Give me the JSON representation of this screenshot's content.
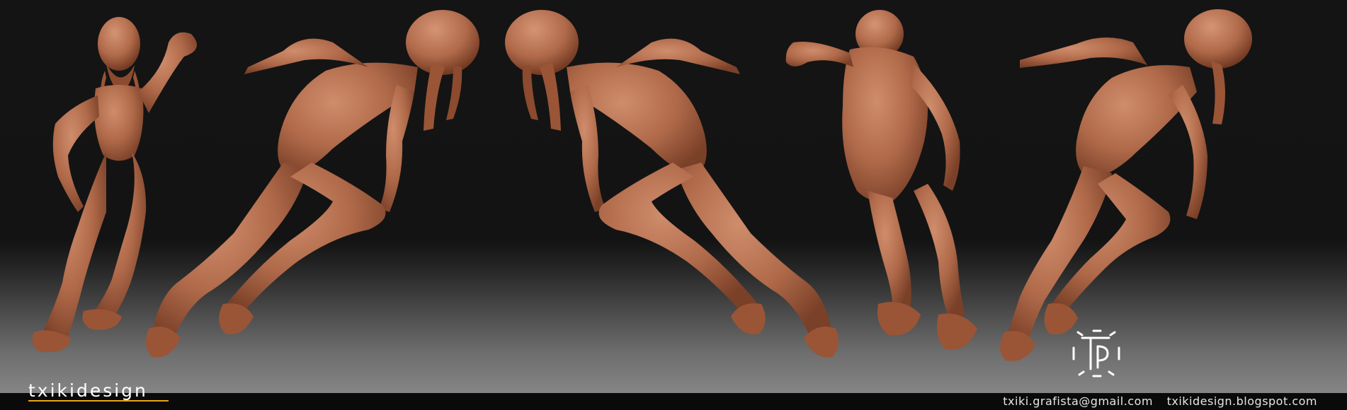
{
  "brand": {
    "name": "txikidesign"
  },
  "contact": {
    "email": "txiki.grafista@gmail.com",
    "blog": "txikidesign.blogspot.com"
  },
  "logo": {
    "icon": "tp-monogram-icon"
  },
  "colors": {
    "skin": "#b06a4a",
    "skin_shadow": "#7a4028",
    "skin_highlight": "#cf8d6c",
    "accent_underline": "#e8a317",
    "background_top": "#141414",
    "background_floor": "#858585",
    "footer_text": "#e6e6e6"
  }
}
